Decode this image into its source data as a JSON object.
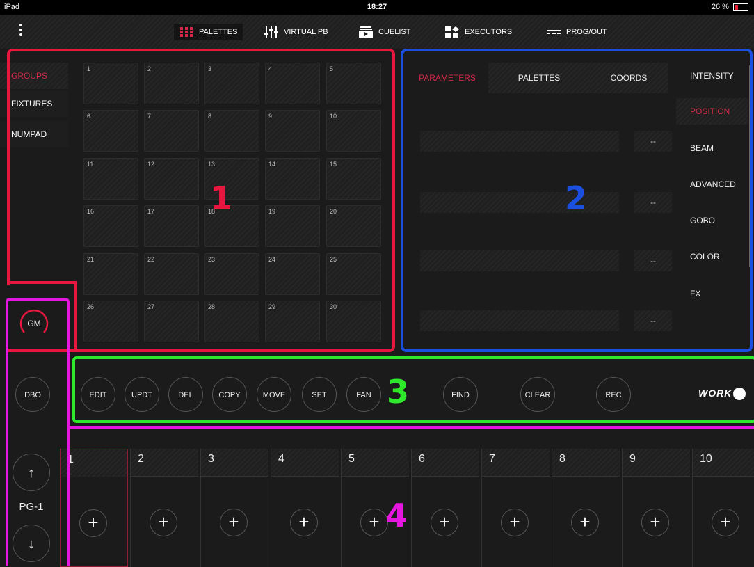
{
  "status": {
    "device": "iPad",
    "time": "18:27",
    "battery": "26 %"
  },
  "nav": {
    "tabs": [
      {
        "label": "PALETTES",
        "icon": "grid-icon"
      },
      {
        "label": "VIRTUAL PB",
        "icon": "sliders-icon"
      },
      {
        "label": "CUELIST",
        "icon": "cuelist-icon"
      },
      {
        "label": "EXECUTORS",
        "icon": "executors-icon"
      },
      {
        "label": "PROG/OUT",
        "icon": "progout-icon"
      }
    ]
  },
  "sidebar": {
    "items": [
      "GROUPS",
      "FIXTURES",
      "NUMPAD"
    ],
    "active": "GROUPS"
  },
  "groups": [
    "1",
    "2",
    "3",
    "4",
    "5",
    "6",
    "7",
    "8",
    "9",
    "10",
    "11",
    "12",
    "13",
    "14",
    "15",
    "16",
    "17",
    "18",
    "19",
    "20",
    "21",
    "22",
    "23",
    "24",
    "25",
    "26",
    "27",
    "28",
    "29",
    "30"
  ],
  "params": {
    "tabs": [
      "PARAMETERS",
      "PALETTES",
      "COORDS"
    ],
    "active_tab": "PARAMETERS",
    "values": [
      "--",
      "--",
      "--",
      "--"
    ],
    "categories": [
      "INTENSITY",
      "POSITION",
      "BEAM",
      "ADVANCED",
      "GOBO",
      "COLOR",
      "FX"
    ],
    "active_category": "POSITION"
  },
  "left": {
    "gm": "GM",
    "dbo": "DBO",
    "page": "PG-1",
    "up": "↑",
    "down": "↓"
  },
  "commands": [
    "EDIT",
    "UPDT",
    "DEL",
    "COPY",
    "MOVE",
    "SET",
    "FAN",
    "FIND",
    "CLEAR",
    "REC"
  ],
  "brand": "WORK",
  "executors": [
    "1",
    "2",
    "3",
    "4",
    "5",
    "6",
    "7",
    "8",
    "9",
    "10"
  ],
  "annotations": [
    "1",
    "2",
    "3",
    "4"
  ],
  "colors": {
    "accent": "#d02a48",
    "area1": "#e8173f",
    "area2": "#1a4fe0",
    "area3": "#2ee82b",
    "area4": "#e516e0"
  }
}
